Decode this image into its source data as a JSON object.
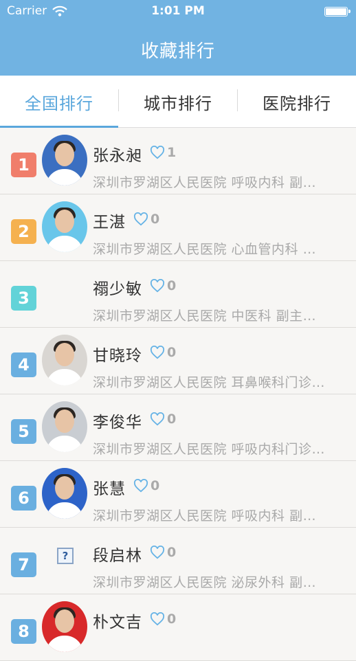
{
  "status": {
    "carrier": "Carrier",
    "time": "1:01 PM"
  },
  "nav": {
    "title": "收藏排行"
  },
  "tabs": [
    {
      "label": "全国排行",
      "active": true
    },
    {
      "label": "城市排行",
      "active": false
    },
    {
      "label": "医院排行",
      "active": false
    }
  ],
  "colors": {
    "header": "#71b3e2",
    "accent": "#5aa7dc"
  },
  "doctors": [
    {
      "rank": "1",
      "name": "张永昶",
      "likes": "1",
      "detail": "深圳市罗湖区人民医院 呼吸内科 副…",
      "rank_color": "#f07e6b",
      "avatar": "photo",
      "avatar_bg": "#3b6fc1"
    },
    {
      "rank": "2",
      "name": "王湛",
      "likes": "0",
      "detail": "深圳市罗湖区人民医院 心血管内科 …",
      "rank_color": "#f5b14f",
      "avatar": "photo",
      "avatar_bg": "#69c6ea"
    },
    {
      "rank": "3",
      "name": "禤少敏",
      "likes": "0",
      "detail": "深圳市罗湖区人民医院 中医科 副主…",
      "rank_color": "#62d3d8",
      "avatar": "none",
      "avatar_bg": ""
    },
    {
      "rank": "4",
      "name": "甘晓玲",
      "likes": "0",
      "detail": "深圳市罗湖区人民医院 耳鼻喉科门诊…",
      "rank_color": "#6aafe0",
      "avatar": "photo",
      "avatar_bg": "#d9d6d2"
    },
    {
      "rank": "5",
      "name": "李俊华",
      "likes": "0",
      "detail": "深圳市罗湖区人民医院 呼吸内科门诊…",
      "rank_color": "#6aafe0",
      "avatar": "photo",
      "avatar_bg": "#c9cdd2"
    },
    {
      "rank": "6",
      "name": "张慧",
      "likes": "0",
      "detail": "深圳市罗湖区人民医院 呼吸内科 副…",
      "rank_color": "#6aafe0",
      "avatar": "photo",
      "avatar_bg": "#2d63c8"
    },
    {
      "rank": "7",
      "name": "段启林",
      "likes": "0",
      "detail": "深圳市罗湖区人民医院 泌尿外科 副…",
      "rank_color": "#6aafe0",
      "avatar": "broken",
      "avatar_bg": ""
    },
    {
      "rank": "8",
      "name": "朴文吉",
      "likes": "0",
      "detail": "",
      "rank_color": "#6aafe0",
      "avatar": "photo",
      "avatar_bg": "#d8292a"
    }
  ]
}
